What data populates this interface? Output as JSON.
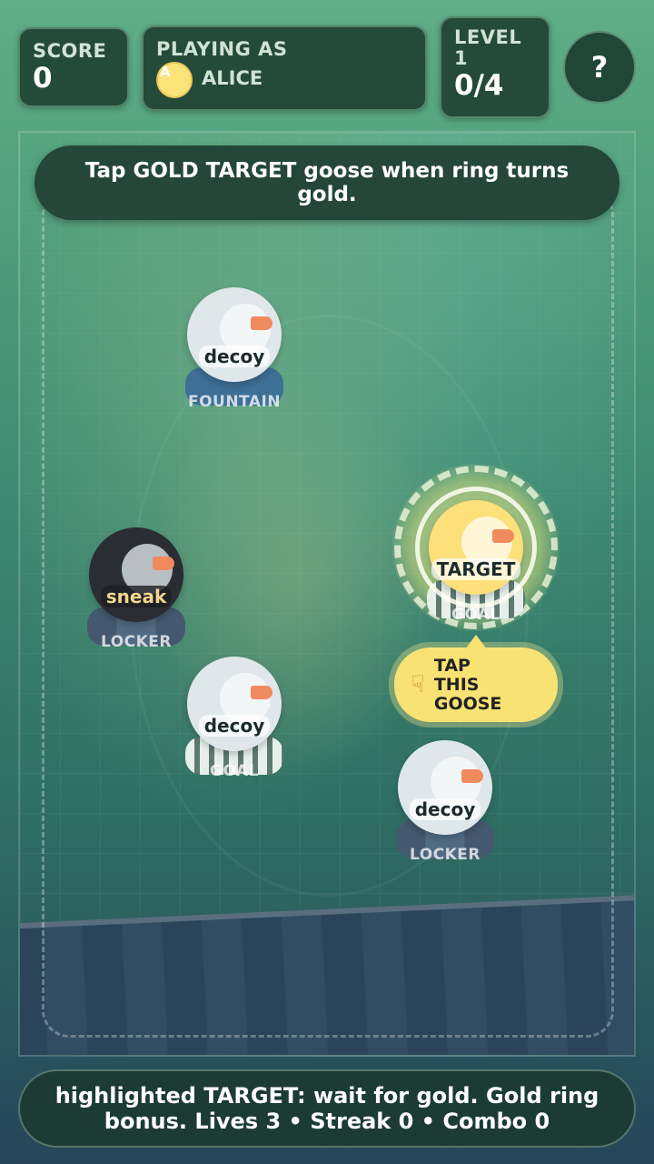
{
  "hud": {
    "score_label": "SCORE",
    "score_value": "0",
    "player_label": "PLAYING AS",
    "player_initial": "A",
    "player_name": "ALICE",
    "level_label": "LEVEL",
    "level_number": "1",
    "level_progress": "0/4",
    "help_label": "?"
  },
  "instruction": "Tap GOLD TARGET goose when ring turns gold.",
  "geese": [
    {
      "tag": "decoy",
      "place": "FOUNTAIN",
      "style": "light",
      "base": "fountain"
    },
    {
      "tag": "TARGET",
      "place": "GOAL",
      "style": "gold",
      "base": "goal"
    },
    {
      "tag": "sneak",
      "place": "LOCKER",
      "style": "dark",
      "base": "locker"
    },
    {
      "tag": "decoy",
      "place": "GOAL",
      "style": "light",
      "base": "goal"
    },
    {
      "tag": "decoy",
      "place": "LOCKER",
      "style": "light",
      "base": "locker"
    }
  ],
  "callout": {
    "icon": "pointing-hand-icon",
    "text": "TAP THIS GOOSE"
  },
  "status": "highlighted TARGET: wait for gold. Gold ring bonus. Lives 3 • Streak 0 • Combo 0",
  "colors": {
    "gold": "#fde07a",
    "panel": "#244a3a",
    "callout": "#f8e274"
  }
}
